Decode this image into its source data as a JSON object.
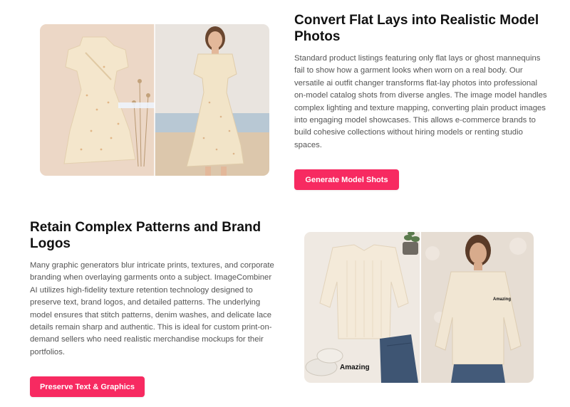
{
  "section1": {
    "title": "Convert Flat Lays into Realistic Model Photos",
    "description": "Standard product listings featuring only flat lays or ghost mannequins fail to show how a garment looks when worn on a real body. Our versatile ai outfit changer transforms flat-lay photos into professional on-model catalog shots from diverse angles. The image model handles complex lighting and texture mapping, converting plain product images into engaging model showcases. This allows e-commerce brands to build cohesive collections without hiring models or renting studio spaces.",
    "button_label": "Generate Model Shots"
  },
  "section2": {
    "title": "Retain Complex Patterns and Brand Logos",
    "description": "Many graphic generators blur intricate prints, textures, and corporate branding when overlaying garments onto a subject. ImageCombiner AI utilizes high-fidelity texture retention technology designed to preserve text, brand logos, and detailed patterns. The underlying model ensures that stitch patterns, denim washes, and delicate lace details remain sharp and authentic. This is ideal for custom print-on-demand sellers who need realistic merchandise mockups for their portfolios.",
    "button_label": "Preserve Text & Graphics",
    "sweater_print_flat": "Amazing",
    "sweater_print_model": "Amazing"
  },
  "colors": {
    "accent": "#f72a61",
    "title": "#111111",
    "body": "#555555"
  }
}
